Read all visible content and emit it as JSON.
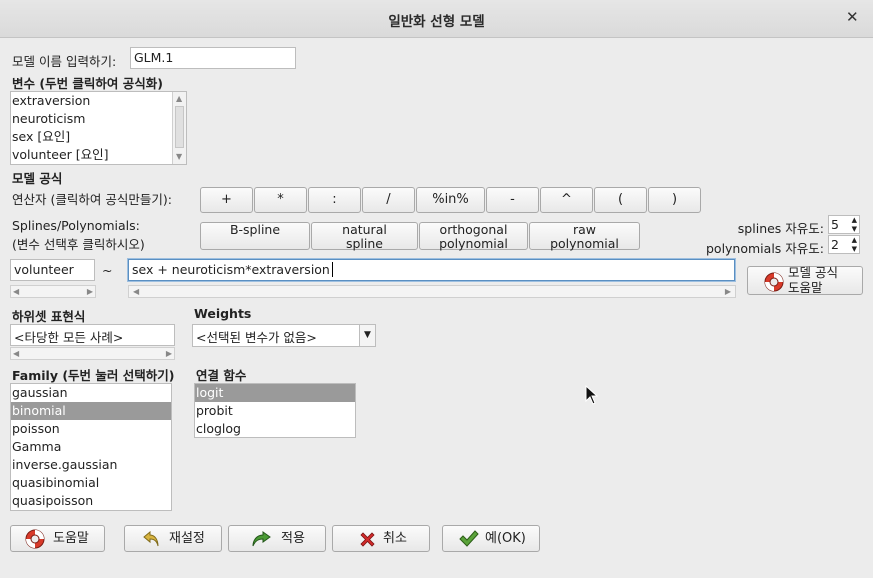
{
  "window": {
    "title": "일반화 선형 모델",
    "close_glyph": "✕"
  },
  "model_name": {
    "label": "모델 이름 입력하기:",
    "value": "GLM.1"
  },
  "variables": {
    "label": "변수 (두번 클릭하여 공식화)",
    "items": [
      "extraversion",
      "neuroticism",
      "sex [요인]",
      "volunteer [요인]"
    ]
  },
  "formula": {
    "section_label": "모델 공식",
    "operators_label": "연산자 (클릭하여 공식만들기):",
    "operators": [
      "+",
      "*",
      ":",
      "/",
      "%in%",
      "-",
      "^",
      "(",
      ")"
    ],
    "splines_label_1": "Splines/Polynomials:",
    "splines_label_2": "(변수 선택후 클릭하시오)",
    "spline_buttons": [
      [
        "B-spline",
        ""
      ],
      [
        "natural",
        "spline"
      ],
      [
        "orthogonal",
        "polynomial"
      ],
      [
        "raw",
        "polynomial"
      ]
    ],
    "splines_df_label": "splines 자유도:",
    "splines_df_value": "5",
    "poly_df_label": "polynomials 자유도:",
    "poly_df_value": "2",
    "lhs": "volunteer",
    "tilde": "~",
    "rhs": "sex + neuroticism*extraversion",
    "help_label_1": "모델 공식",
    "help_label_2": "도움말"
  },
  "subset": {
    "label": "하위셋 표현식",
    "value": "<타당한 모든 사례>"
  },
  "weights": {
    "label": "Weights",
    "value": "<선택된 변수가 없음>"
  },
  "family": {
    "label": "Family (두번 눌러 선택하기)",
    "items": [
      "gaussian",
      "binomial",
      "poisson",
      "Gamma",
      "inverse.gaussian",
      "quasibinomial",
      "quasipoisson"
    ],
    "selected": "binomial"
  },
  "link": {
    "label": "연결 함수",
    "items": [
      "logit",
      "probit",
      "cloglog"
    ],
    "selected": "logit"
  },
  "buttons": {
    "help": "도움말",
    "reset": "재설정",
    "apply": "적용",
    "cancel": "취소",
    "ok": "예(OK)"
  },
  "colors": {
    "selection": "#9a9a9a",
    "focus_border": "#5a8fc2",
    "cancel_red": "#d12b2b",
    "ok_green": "#4a8a2c"
  }
}
